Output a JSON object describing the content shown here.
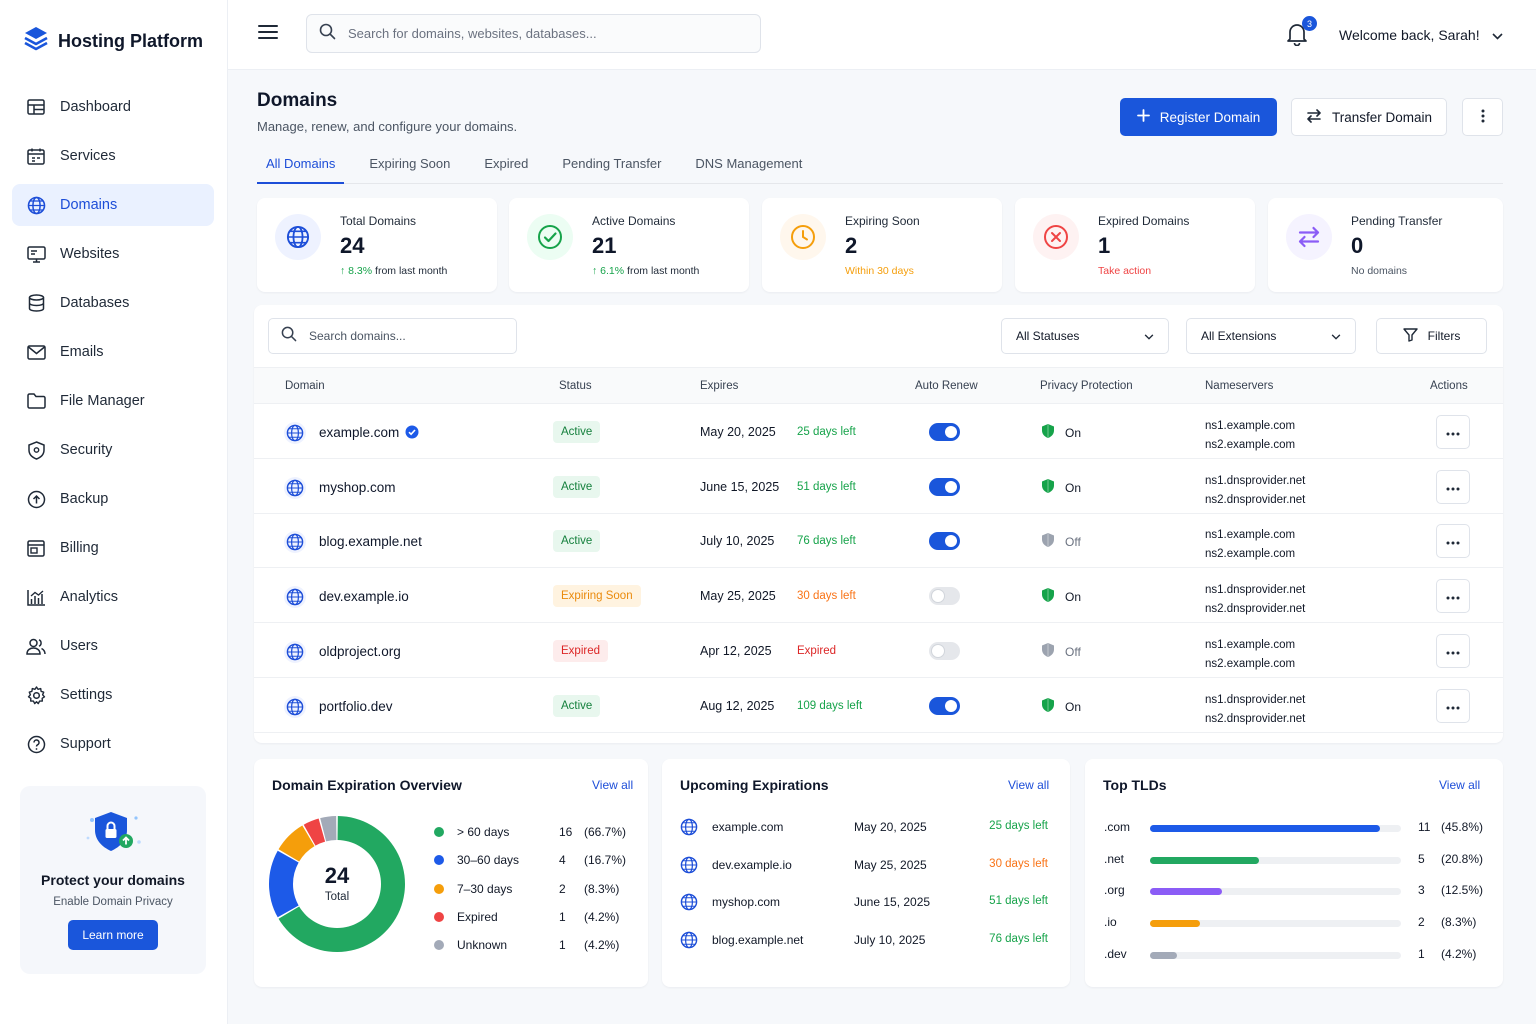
{
  "brand": {
    "title": "Hosting Platform"
  },
  "nav": [
    {
      "label": "Dashboard",
      "icon": "dashboard-icon"
    },
    {
      "label": "Services",
      "icon": "services-icon"
    },
    {
      "label": "Domains",
      "icon": "globe-icon",
      "active": true
    },
    {
      "label": "Websites",
      "icon": "monitor-icon"
    },
    {
      "label": "Databases",
      "icon": "database-icon"
    },
    {
      "label": "Emails",
      "icon": "mail-icon"
    },
    {
      "label": "File Manager",
      "icon": "folder-icon"
    },
    {
      "label": "Security",
      "icon": "shield-icon"
    },
    {
      "label": "Backup",
      "icon": "backup-icon"
    },
    {
      "label": "Billing",
      "icon": "billing-icon"
    },
    {
      "label": "Analytics",
      "icon": "analytics-icon"
    },
    {
      "label": "Users",
      "icon": "users-icon"
    },
    {
      "label": "Settings",
      "icon": "gear-icon"
    },
    {
      "label": "Support",
      "icon": "help-icon"
    }
  ],
  "promo": {
    "title": "Protect your domains",
    "subtitle": "Enable Domain Privacy",
    "button": "Learn more"
  },
  "topbar": {
    "search_placeholder": "Search for domains, websites, databases...",
    "notification_count": "3",
    "welcome": "Welcome back, Sarah!"
  },
  "page": {
    "title": "Domains",
    "subtitle": "Manage, renew, and configure your domains.",
    "register_button": "Register Domain",
    "transfer_button": "Transfer Domain"
  },
  "tabs": [
    "All Domains",
    "Expiring Soon",
    "Expired",
    "Pending Transfer",
    "DNS Management"
  ],
  "stats": [
    {
      "label": "Total Domains",
      "value": "24",
      "trend": "8.3%",
      "note": "from last month",
      "color": "#1d4ed8",
      "bg": "#eef2ff"
    },
    {
      "label": "Active Domains",
      "value": "21",
      "trend": "6.1%",
      "note": "from last month",
      "color": "#16a34a",
      "bg": "#ecfdf3"
    },
    {
      "label": "Expiring Soon",
      "value": "2",
      "note": "Within 30 days",
      "color": "#f59e0b",
      "bg": "#fff7ed"
    },
    {
      "label": "Expired Domains",
      "value": "1",
      "note": "Take action",
      "color": "#ef4444",
      "bg": "#fef2f2"
    },
    {
      "label": "Pending Transfer",
      "value": "0",
      "note": "No domains",
      "color": "#8b5cf6",
      "bg": "#f5f3ff"
    }
  ],
  "table": {
    "search_placeholder": "Search domains...",
    "status_filter": "All Statuses",
    "extension_filter": "All Extensions",
    "filters_button": "Filters",
    "columns": [
      "Domain",
      "Status",
      "Expires",
      "Auto Renew",
      "Privacy Protection",
      "Nameservers",
      "Actions"
    ],
    "rows": [
      {
        "domain": "example.com",
        "verified": true,
        "status": "Active",
        "expires": "May 20, 2025",
        "left": "25 days left",
        "auto_renew": true,
        "privacy": "On",
        "ns1": "ns1.example.com",
        "ns2": "ns2.example.com"
      },
      {
        "domain": "myshop.com",
        "status": "Active",
        "expires": "June 15, 2025",
        "left": "51 days left",
        "auto_renew": true,
        "privacy": "On",
        "ns1": "ns1.dnsprovider.net",
        "ns2": "ns2.dnsprovider.net"
      },
      {
        "domain": "blog.example.net",
        "status": "Active",
        "expires": "July 10, 2025",
        "left": "76 days left",
        "auto_renew": true,
        "privacy": "Off",
        "ns1": "ns1.example.com",
        "ns2": "ns2.example.com"
      },
      {
        "domain": "dev.example.io",
        "status": "Expiring Soon",
        "expires": "May 25, 2025",
        "left": "30 days left",
        "auto_renew": false,
        "privacy": "On",
        "ns1": "ns1.dnsprovider.net",
        "ns2": "ns2.dnsprovider.net"
      },
      {
        "domain": "oldproject.org",
        "status": "Expired",
        "expires": "Apr 12, 2025",
        "left": "Expired",
        "auto_renew": false,
        "privacy": "Off",
        "ns1": "ns1.example.com",
        "ns2": "ns2.example.com"
      },
      {
        "domain": "portfolio.dev",
        "status": "Active",
        "expires": "Aug 12, 2025",
        "left": "109 days left",
        "auto_renew": true,
        "privacy": "On",
        "ns1": "ns1.dnsprovider.net",
        "ns2": "ns2.dnsprovider.net"
      }
    ]
  },
  "overview": {
    "title": "Domain Expiration Overview",
    "view_all": "View all",
    "total": "24",
    "total_label": "Total",
    "segments": [
      {
        "label": "> 60 days",
        "count": 16,
        "pct": "(66.7%)",
        "color": "#22a861"
      },
      {
        "label": "30–60 days",
        "count": 4,
        "pct": "(16.7%)",
        "color": "#1d5ae8"
      },
      {
        "label": "7–30 days",
        "count": 2,
        "pct": "(8.3%)",
        "color": "#f59e0b"
      },
      {
        "label": "Expired",
        "count": 1,
        "pct": "(4.2%)",
        "color": "#ef4444"
      },
      {
        "label": "Unknown",
        "count": 1,
        "pct": "(4.2%)",
        "color": "#a3aab8"
      }
    ]
  },
  "upcoming": {
    "title": "Upcoming Expirations",
    "view_all": "View all",
    "items": [
      {
        "domain": "example.com",
        "date": "May 20, 2025",
        "left": "25 days left",
        "color": "#16a34a"
      },
      {
        "domain": "dev.example.io",
        "date": "May 25, 2025",
        "left": "30 days left",
        "color": "#f97316"
      },
      {
        "domain": "myshop.com",
        "date": "June 15, 2025",
        "left": "51 days left",
        "color": "#16a34a"
      },
      {
        "domain": "blog.example.net",
        "date": "July 10, 2025",
        "left": "76 days left",
        "color": "#16a34a"
      }
    ]
  },
  "tlds": {
    "title": "Top TLDs",
    "view_all": "View all",
    "items": [
      {
        "tld": ".com",
        "count": 11,
        "pct": "(45.8%)",
        "fraction": 0.917,
        "color": "#1d5ae8"
      },
      {
        "tld": ".net",
        "count": 5,
        "pct": "(20.8%)",
        "fraction": 0.434,
        "color": "#22a861"
      },
      {
        "tld": ".org",
        "count": 3,
        "pct": "(12.5%)",
        "fraction": 0.287,
        "color": "#8b5cf6"
      },
      {
        "tld": ".io",
        "count": 2,
        "pct": "(8.3%)",
        "fraction": 0.199,
        "color": "#f59e0b"
      },
      {
        "tld": ".dev",
        "count": 1,
        "pct": "(4.2%)",
        "fraction": 0.108,
        "color": "#a3aab8"
      }
    ]
  }
}
